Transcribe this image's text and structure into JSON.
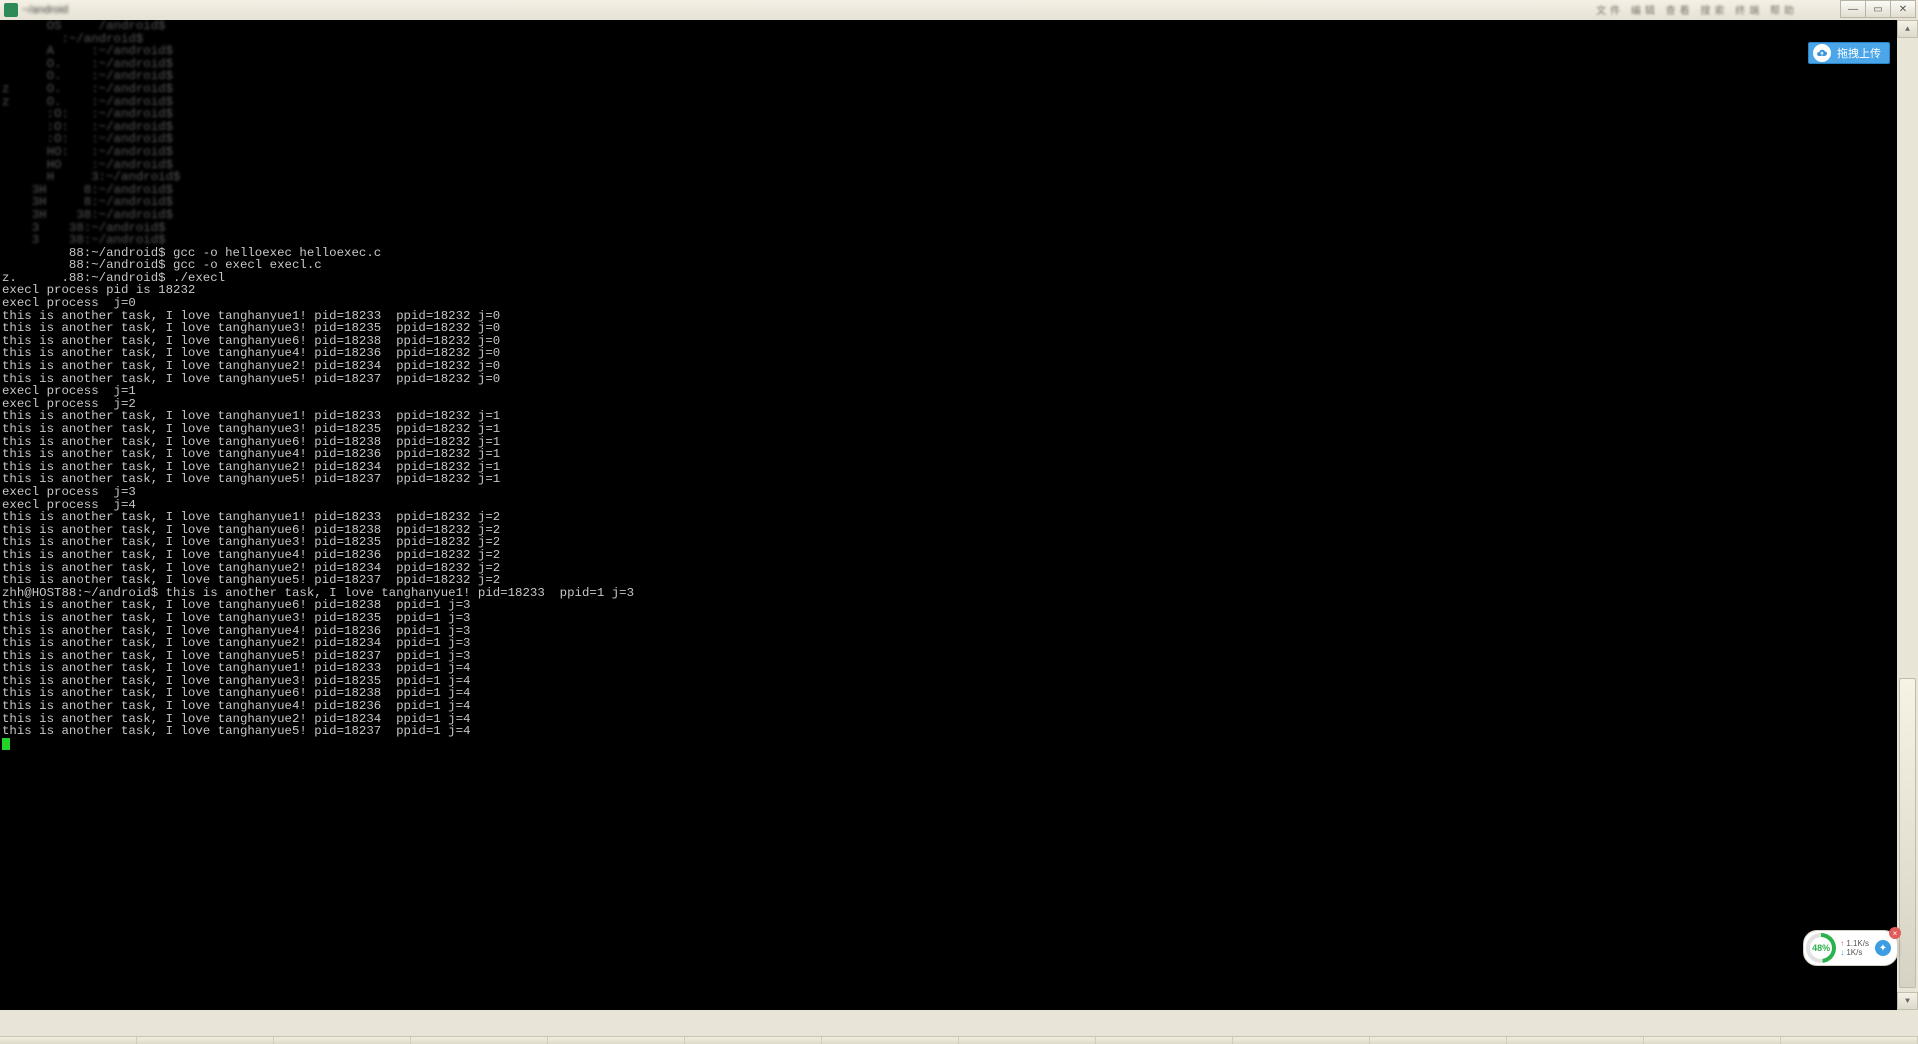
{
  "window": {
    "title": "~/android",
    "menu_hint": "文件  编辑  查看  搜索  终端  帮助",
    "buttons": {
      "min": "—",
      "max": "▭",
      "close": "✕"
    }
  },
  "upload": {
    "label": "拖拽上传"
  },
  "netmon": {
    "percent": "48%",
    "up": "1.1K/s",
    "down": "1K/s"
  },
  "prompt_redacted": "z    HO    :~/android$",
  "prompt_half": "     HO    :~/android$",
  "prompt_host": "zhh@HOST88:~/android$",
  "terminal_lines": [
    {
      "t": "      OS     /android$",
      "cls": "smudge"
    },
    {
      "t": "        :~/android$",
      "cls": "smudge"
    },
    {
      "t": "      A     :~/android$",
      "cls": "smudge"
    },
    {
      "t": "      O.    :~/android$",
      "cls": "smudge"
    },
    {
      "t": "      O.    :~/android$",
      "cls": "smudge"
    },
    {
      "t": "z     O.    :~/android$",
      "cls": "smudge"
    },
    {
      "t": "z     O.    :~/android$",
      "cls": "smudge"
    },
    {
      "t": "      :O:   :~/android$",
      "cls": "smudge"
    },
    {
      "t": "      :O:   :~/android$",
      "cls": "smudge"
    },
    {
      "t": "      :O:   :~/android$",
      "cls": "smudge"
    },
    {
      "t": "      HO:   :~/android$",
      "cls": "smudge"
    },
    {
      "t": "      HO    :~/android$",
      "cls": "smudge"
    },
    {
      "t": "      H     3:~/android$",
      "cls": "smudge"
    },
    {
      "t": "    3H     8:~/android$",
      "cls": "smudge"
    },
    {
      "t": "    3H     8:~/android$",
      "cls": "smudge"
    },
    {
      "t": "    3H    38:~/android$",
      "cls": "smudge"
    },
    {
      "t": "    3    38:~/android$",
      "cls": "smudge"
    },
    {
      "t": "    3    38:~/android$",
      "cls": "smudge"
    },
    {
      "t": "         88:~/android$ gcc -o helloexec helloexec.c"
    },
    {
      "t": "         88:~/android$ gcc -o execl execl.c"
    },
    {
      "t": "z.      .88:~/android$ ./execl"
    },
    {
      "t": "execl process pid is 18232"
    },
    {
      "t": ""
    },
    {
      "t": "execl process  j=0"
    },
    {
      "t": "this is another task, I love tanghanyue1! pid=18233  ppid=18232 j=0"
    },
    {
      "t": "this is another task, I love tanghanyue3! pid=18235  ppid=18232 j=0"
    },
    {
      "t": "this is another task, I love tanghanyue6! pid=18238  ppid=18232 j=0"
    },
    {
      "t": "this is another task, I love tanghanyue4! pid=18236  ppid=18232 j=0"
    },
    {
      "t": "this is another task, I love tanghanyue2! pid=18234  ppid=18232 j=0"
    },
    {
      "t": "this is another task, I love tanghanyue5! pid=18237  ppid=18232 j=0"
    },
    {
      "t": ""
    },
    {
      "t": "execl process  j=1"
    },
    {
      "t": ""
    },
    {
      "t": "execl process  j=2"
    },
    {
      "t": "this is another task, I love tanghanyue1! pid=18233  ppid=18232 j=1"
    },
    {
      "t": "this is another task, I love tanghanyue3! pid=18235  ppid=18232 j=1"
    },
    {
      "t": "this is another task, I love tanghanyue6! pid=18238  ppid=18232 j=1"
    },
    {
      "t": "this is another task, I love tanghanyue4! pid=18236  ppid=18232 j=1"
    },
    {
      "t": "this is another task, I love tanghanyue2! pid=18234  ppid=18232 j=1"
    },
    {
      "t": "this is another task, I love tanghanyue5! pid=18237  ppid=18232 j=1"
    },
    {
      "t": ""
    },
    {
      "t": "execl process  j=3"
    },
    {
      "t": ""
    },
    {
      "t": "execl process  j=4"
    },
    {
      "t": "this is another task, I love tanghanyue1! pid=18233  ppid=18232 j=2"
    },
    {
      "t": "this is another task, I love tanghanyue6! pid=18238  ppid=18232 j=2"
    },
    {
      "t": "this is another task, I love tanghanyue3! pid=18235  ppid=18232 j=2"
    },
    {
      "t": "this is another task, I love tanghanyue4! pid=18236  ppid=18232 j=2"
    },
    {
      "t": "this is another task, I love tanghanyue2! pid=18234  ppid=18232 j=2"
    },
    {
      "t": "this is another task, I love tanghanyue5! pid=18237  ppid=18232 j=2"
    },
    {
      "t": "zhh@HOST88:~/android$ this is another task, I love tanghanyue1! pid=18233  ppid=1 j=3"
    },
    {
      "t": "this is another task, I love tanghanyue6! pid=18238  ppid=1 j=3"
    },
    {
      "t": "this is another task, I love tanghanyue3! pid=18235  ppid=1 j=3"
    },
    {
      "t": "this is another task, I love tanghanyue4! pid=18236  ppid=1 j=3"
    },
    {
      "t": "this is another task, I love tanghanyue2! pid=18234  ppid=1 j=3"
    },
    {
      "t": "this is another task, I love tanghanyue5! pid=18237  ppid=1 j=3"
    },
    {
      "t": "this is another task, I love tanghanyue1! pid=18233  ppid=1 j=4"
    },
    {
      "t": "this is another task, I love tanghanyue3! pid=18235  ppid=1 j=4"
    },
    {
      "t": "this is another task, I love tanghanyue6! pid=18238  ppid=1 j=4"
    },
    {
      "t": "this is another task, I love tanghanyue4! pid=18236  ppid=1 j=4"
    },
    {
      "t": "this is another task, I love tanghanyue2! pid=18234  ppid=1 j=4"
    },
    {
      "t": "this is another task, I love tanghanyue5! pid=18237  ppid=1 j=4"
    }
  ]
}
